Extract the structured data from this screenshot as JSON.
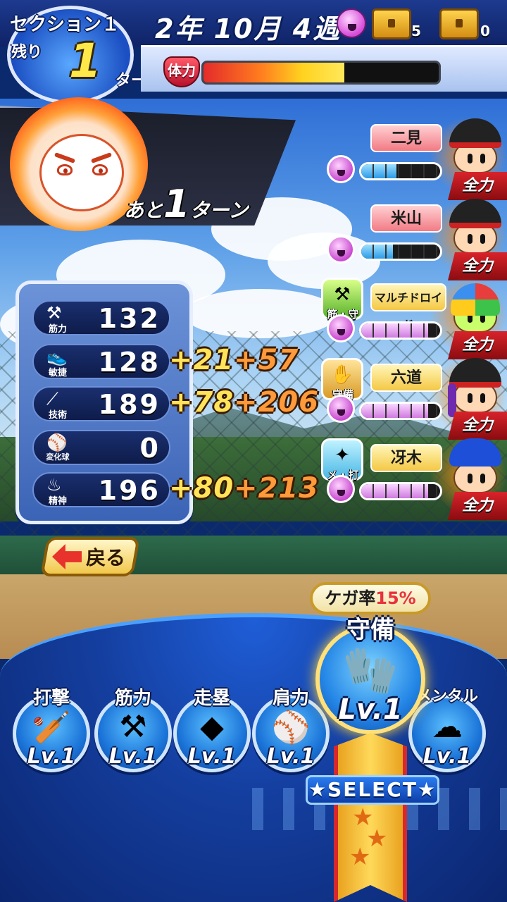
{
  "header": {
    "section_title": "セクション１",
    "remaining_label": "残り",
    "remaining_turns": "1",
    "turn_unit": "ターン",
    "date": "2年 10月 4週",
    "chest_counts": [
      "5",
      "0"
    ],
    "stamina_label": "体力",
    "stamina_level": 0.6
  },
  "banner": {
    "text_before": "あと",
    "count": "1",
    "text_after": "ターン"
  },
  "stats": [
    {
      "label": "筋力",
      "icon": "dumbbell-icon",
      "value": "132",
      "bonus1": "",
      "bonus2": ""
    },
    {
      "label": "敏捷",
      "icon": "shoe-icon",
      "value": "128",
      "bonus1": "+21",
      "bonus2": "+57"
    },
    {
      "label": "技術",
      "icon": "bat-icon",
      "value": "189",
      "bonus1": "+78",
      "bonus2": "+206"
    },
    {
      "label": "変化球",
      "icon": "ball-spin-icon",
      "value": "0",
      "bonus1": "",
      "bonus2": ""
    },
    {
      "label": "精神",
      "icon": "flame-icon",
      "value": "196",
      "bonus1": "+80",
      "bonus2": "+213"
    }
  ],
  "back_button": "戻る",
  "team": [
    {
      "name": "二見",
      "plate": "red",
      "bond_color": "blue",
      "bond_level": 0.45,
      "skill": "",
      "avatar": "cap-player",
      "status": "全力"
    },
    {
      "name": "米山",
      "plate": "red",
      "bond_color": "blue",
      "bond_level": 0.4,
      "skill": "",
      "avatar": "cap-player",
      "status": "全力"
    },
    {
      "name": "マルチドロイド",
      "plate": "yellow",
      "bond_color": "pink",
      "bond_level": 0.85,
      "skill": "筋・守",
      "avatar": "android",
      "status": "全力"
    },
    {
      "name": "六道",
      "plate": "yellow",
      "bond_color": "pink",
      "bond_level": 0.85,
      "skill": "守備",
      "avatar": "purple-hair",
      "status": "全力"
    },
    {
      "name": "冴木",
      "plate": "yellow",
      "bond_color": "pink",
      "bond_level": 0.85,
      "skill": "メ・打",
      "avatar": "blue-hair",
      "status": "全力"
    }
  ],
  "injury": {
    "label": "ケガ率",
    "rate": "15%"
  },
  "practices": [
    {
      "name": "打撃",
      "level": "Lv.1",
      "icon": "bat-icon"
    },
    {
      "name": "筋力",
      "level": "Lv.1",
      "icon": "dumbbell-icon"
    },
    {
      "name": "走塁",
      "level": "Lv.1",
      "icon": "base-icon"
    },
    {
      "name": "肩力",
      "level": "Lv.1",
      "icon": "pitch-ball-icon"
    },
    {
      "name": "メンタル",
      "level": "Lv.1",
      "icon": "cloud-icon"
    }
  ],
  "selected_practice": {
    "name": "守備",
    "level": "Lv.1",
    "icon": "glove-icon"
  },
  "select_label": "★SELECT★"
}
